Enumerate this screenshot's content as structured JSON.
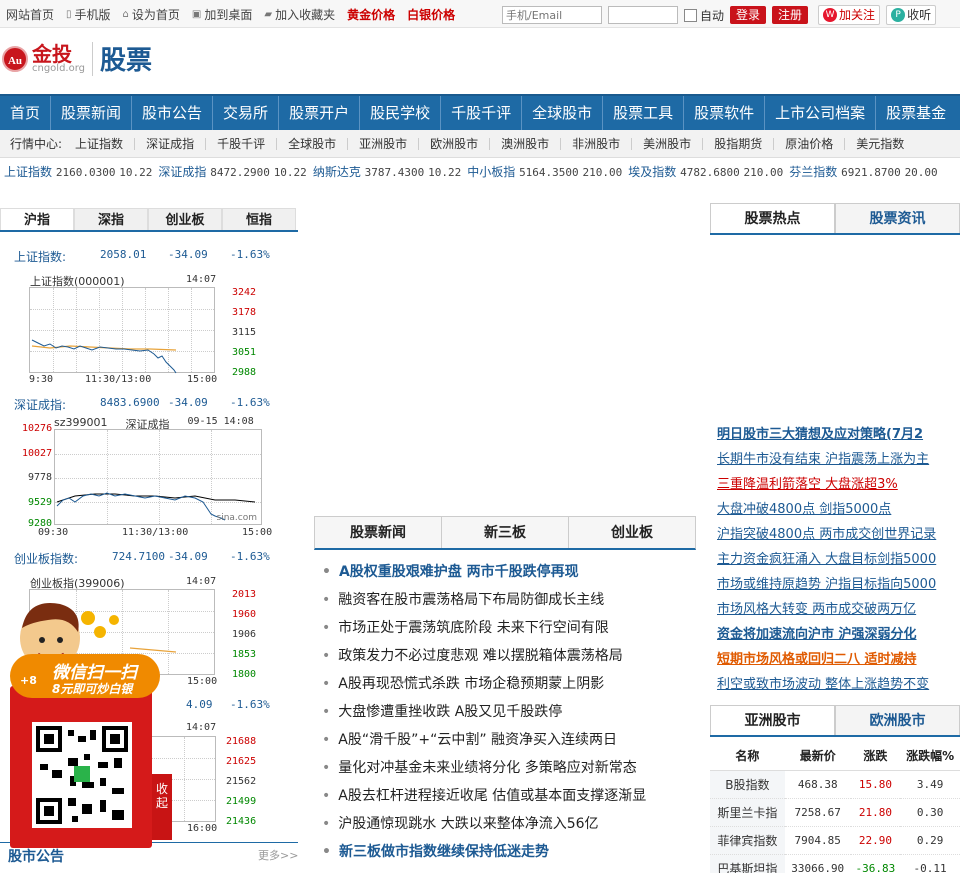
{
  "topbar": {
    "links": [
      {
        "label": "网站首页",
        "icon": ""
      },
      {
        "label": "手机版",
        "icon": "phone-icon"
      },
      {
        "label": "设为首页",
        "icon": "home-icon"
      },
      {
        "label": "加到桌面",
        "icon": "desktop-icon"
      },
      {
        "label": "加入收藏夹",
        "icon": "folder-icon"
      }
    ],
    "gold_price": "黄金价格",
    "silver_price": "白银价格",
    "username_placeholder": "手机/Email",
    "auto_label": "自动",
    "login_button": "登录",
    "register_button": "注册",
    "weibo_follow": "加关注",
    "listen_label": "收听"
  },
  "header": {
    "logo_badge": "Au",
    "logo_text": "金投",
    "logo_domain": "cngold.org",
    "section_title": "股票"
  },
  "nav": [
    "首页",
    "股票新闻",
    "股市公告",
    "交易所",
    "股票开户",
    "股民学校",
    "千股千评",
    "全球股市",
    "股票工具",
    "股票软件",
    "上市公司档案",
    "股票基金"
  ],
  "subnav": {
    "label": "行情中心:",
    "items": [
      "上证指数",
      "深证成指",
      "千股千评",
      "全球股市",
      "亚洲股市",
      "欧洲股市",
      "澳洲股市",
      "非洲股市",
      "美洲股市",
      "股指期货",
      "原油价格",
      "美元指数"
    ]
  },
  "ticker": [
    {
      "name": "上证指数",
      "value": "2160.0300",
      "change": "10.22"
    },
    {
      "name": "深证成指",
      "value": "8472.2900",
      "change": "10.22"
    },
    {
      "name": "纳斯达克",
      "value": "3787.4300",
      "change": "10.22"
    },
    {
      "name": "中小板指",
      "value": "5164.3500",
      "change": "210.00"
    },
    {
      "name": "埃及指数",
      "value": "4782.6800",
      "change": "210.00"
    },
    {
      "name": "芬兰指数",
      "value": "6921.8700",
      "change": "20.00"
    }
  ],
  "index_tabs": [
    "沪指",
    "深指",
    "创业板",
    "恒指"
  ],
  "sh": {
    "label": "上证指数:",
    "value": "2058.01",
    "change": "-34.09",
    "pct": "-1.63%",
    "chart_title": "上证指数(000001)",
    "time": "14:07",
    "levels": [
      "3242",
      "3178",
      "3115",
      "3051",
      "2988"
    ],
    "x_labels": [
      "9:30",
      "11:30/13:00",
      "15:00"
    ]
  },
  "sz": {
    "label": "深证成指:",
    "value": "8483.6900",
    "change": "-34.09",
    "pct": "-1.63%",
    "chart_code": "sz399001",
    "chart_name": "深证成指",
    "date_time": "09-15 14:08",
    "levels": [
      "10276",
      "10027",
      "9778",
      "9529",
      "9280"
    ],
    "x_labels": [
      "09:30",
      "11:30/13:00",
      "15:00"
    ],
    "watermark": "sina.com"
  },
  "cyb": {
    "label": "创业板指数:",
    "value": "724.7100",
    "change": "-34.09",
    "pct": "-1.63%",
    "chart_title": "创业板指(399006)",
    "time": "14:07",
    "levels": [
      "2013",
      "1960",
      "1906",
      "1853",
      "1800"
    ],
    "x_label_end": "15:00"
  },
  "hs": {
    "change": "4.09",
    "pct": "-1.63%",
    "time": "14:07",
    "levels": [
      "21688",
      "21625",
      "21562",
      "21499",
      "21436"
    ],
    "x_label_end": "16:00"
  },
  "left_bottom": {
    "title": "股市公告",
    "more": "更多>>"
  },
  "promo": {
    "line1": "微信扫一扫",
    "line2": "8元即可炒白银",
    "badge": "+8",
    "collapse": "收起"
  },
  "news_tabs": [
    "股票新闻",
    "新三板",
    "创业板"
  ],
  "news": [
    {
      "text": "A股权重股艰难护盘 两市千股跌停再现",
      "bold": true
    },
    {
      "text": "融资客在股市震荡格局下布局防御成长主线",
      "bold": false
    },
    {
      "text": "市场正处于震荡筑底阶段 未来下行空间有限",
      "bold": false
    },
    {
      "text": "政策发力不必过度悲观 难以摆脱箱体震荡格局",
      "bold": false
    },
    {
      "text": "A股再现恐慌式杀跌 市场企稳预期蒙上阴影",
      "bold": false
    },
    {
      "text": "大盘惨遭重挫收跌 A股又见千股跌停",
      "bold": false
    },
    {
      "text": "A股“滑千股”+“云中割” 融资净买入连续两日",
      "bold": false
    },
    {
      "text": "量化对冲基金未来业绩将分化 多策略应对新常态",
      "bold": false
    },
    {
      "text": "A股去杠杆进程接近收尾 估值或基本面支撑逐渐显",
      "bold": false
    },
    {
      "text": "沪股通惊现跳水 大跌以来整体净流入56亿",
      "bold": false
    },
    {
      "text": "新三板做市指数继续保持低迷走势",
      "bold": true
    }
  ],
  "hot_tabs": [
    "股票热点",
    "股票资讯"
  ],
  "hot": [
    {
      "text": "明日股市三大猜想及应对策略(7月2",
      "style": "b"
    },
    {
      "text": "长期牛市没有结束 沪指震荡上涨为主",
      "style": ""
    },
    {
      "text": "三重降温利箭落空 大盘涨超3%",
      "style": "r"
    },
    {
      "text": "大盘冲破4800点 剑指5000点",
      "style": ""
    },
    {
      "text": "沪指突破4800点 两市成交创世界记录",
      "style": ""
    },
    {
      "text": "主力资金疯狂涌入 大盘目标剑指5000",
      "style": ""
    },
    {
      "text": "市场或维持原趋势 沪指目标指向5000",
      "style": ""
    },
    {
      "text": "市场风格大转变 两市成交破两万亿",
      "style": ""
    },
    {
      "text": "资金将加速流向沪市 沪强深弱分化",
      "style": "b"
    },
    {
      "text": "短期市场风格或回归二八 适时减持",
      "style": "rb"
    },
    {
      "text": "利空或致市场波动 整体上涨趋势不变",
      "style": ""
    }
  ],
  "market_tabs": [
    "亚洲股市",
    "欧洲股市"
  ],
  "market_headers": [
    "名称",
    "最新价",
    "涨跌",
    "涨跌幅%"
  ],
  "markets": [
    {
      "name": "B股指数",
      "price": "468.38",
      "change": "15.80",
      "pct": "3.49"
    },
    {
      "name": "斯里兰卡指",
      "price": "7258.67",
      "change": "21.80",
      "pct": "0.30"
    },
    {
      "name": "菲律宾指数",
      "price": "7904.85",
      "change": "22.90",
      "pct": "0.29"
    },
    {
      "name": "巴基斯坦指",
      "price": "33066.90",
      "change": "-36.83",
      "pct": "-0.11"
    }
  ],
  "colors": {
    "nav_blue": "#1e6aa5",
    "brand_red": "#c8161d",
    "link_blue": "#1d5a93",
    "up": "#c00",
    "down": "#080"
  }
}
